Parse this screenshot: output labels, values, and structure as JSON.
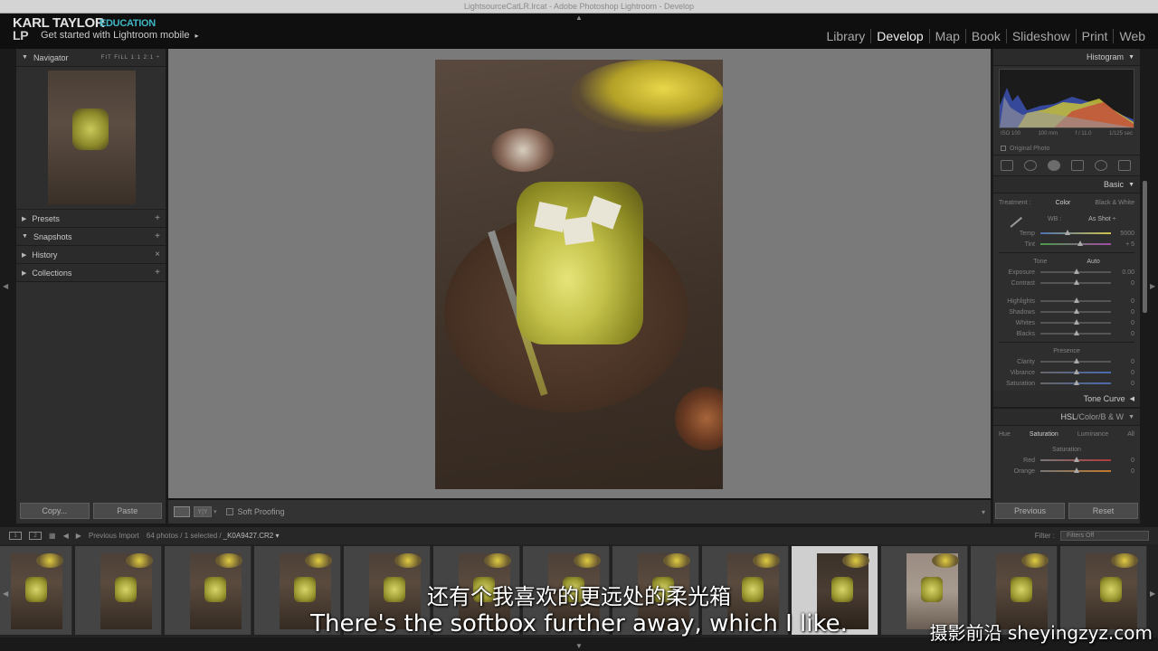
{
  "window": {
    "title": "LightsourceCatLR.lrcat - Adobe Photoshop Lightroom - Develop"
  },
  "brand": {
    "name": "KARL TAYLOR",
    "monogram": "LP",
    "tag": "EDUCATION",
    "mobile": "Get started with Lightroom mobile",
    "mobile_arrow": "▸"
  },
  "modules": [
    "Library",
    "Develop",
    "Map",
    "Book",
    "Slideshow",
    "Print",
    "Web"
  ],
  "left": {
    "navigator": {
      "title": "Navigator",
      "options": "FIT  FILL  1:1  2:1 ÷"
    },
    "panels": [
      {
        "label": "Presets",
        "action": "+"
      },
      {
        "label": "Snapshots",
        "action": "+"
      },
      {
        "label": "History",
        "action": "×"
      },
      {
        "label": "Collections",
        "action": "+"
      }
    ],
    "copy": "Copy...",
    "paste": "Paste"
  },
  "toolbar": {
    "view_icon": "Y|Y",
    "soft_proofing": "Soft Proofing"
  },
  "right": {
    "histogram": {
      "title": "Histogram",
      "iso": "ISO 100",
      "focal": "100 mm",
      "aperture": "f / 11.0",
      "shutter": "1/125 sec",
      "original": "Original Photo"
    },
    "basic": {
      "title": "Basic",
      "treatment": "Treatment :",
      "color": "Color",
      "bw": "Black & White",
      "wb": "WB :",
      "wb_value": "As Shot ÷",
      "temp": {
        "label": "Temp",
        "value": "5000"
      },
      "tint": {
        "label": "Tint",
        "value": "+ 5"
      },
      "tone": "Tone",
      "auto": "Auto",
      "tone_rows": [
        {
          "label": "Exposure",
          "value": "0.00"
        },
        {
          "label": "Contrast",
          "value": "0"
        },
        {
          "label": "Highlights",
          "value": "0"
        },
        {
          "label": "Shadows",
          "value": "0"
        },
        {
          "label": "Whites",
          "value": "0"
        },
        {
          "label": "Blacks",
          "value": "0"
        }
      ],
      "presence": "Presence",
      "presence_rows": [
        {
          "label": "Clarity",
          "value": "0"
        },
        {
          "label": "Vibrance",
          "value": "0"
        },
        {
          "label": "Saturation",
          "value": "0"
        }
      ]
    },
    "tone_curve": "Tone Curve",
    "hsl": {
      "hsl": "HSL",
      "sep1": " / ",
      "color": "Color",
      "sep2": " / ",
      "bw": "B & W"
    },
    "hsl_tabs": [
      "Hue",
      "Saturation",
      "Luminance",
      "All"
    ],
    "hsl_section": "Saturation",
    "hsl_rows": [
      {
        "label": "Red",
        "value": "0"
      },
      {
        "label": "Orange",
        "value": "0"
      }
    ],
    "previous": "Previous",
    "reset": "Reset"
  },
  "filmstrip": {
    "screen1": "1",
    "screen2": "2",
    "source": "Previous Import",
    "count": "64 photos / 1 selected /",
    "file": "_K0A9427.CR2 ▾",
    "filter_label": "Filter :",
    "filter_value": "Filters Off",
    "selected_index": 9
  },
  "subtitles": {
    "cn": "还有个我喜欢的更远处的柔光箱",
    "en": "There's the softbox further away, which I like."
  },
  "watermark": "摄影前沿 sheyingzyz.com"
}
